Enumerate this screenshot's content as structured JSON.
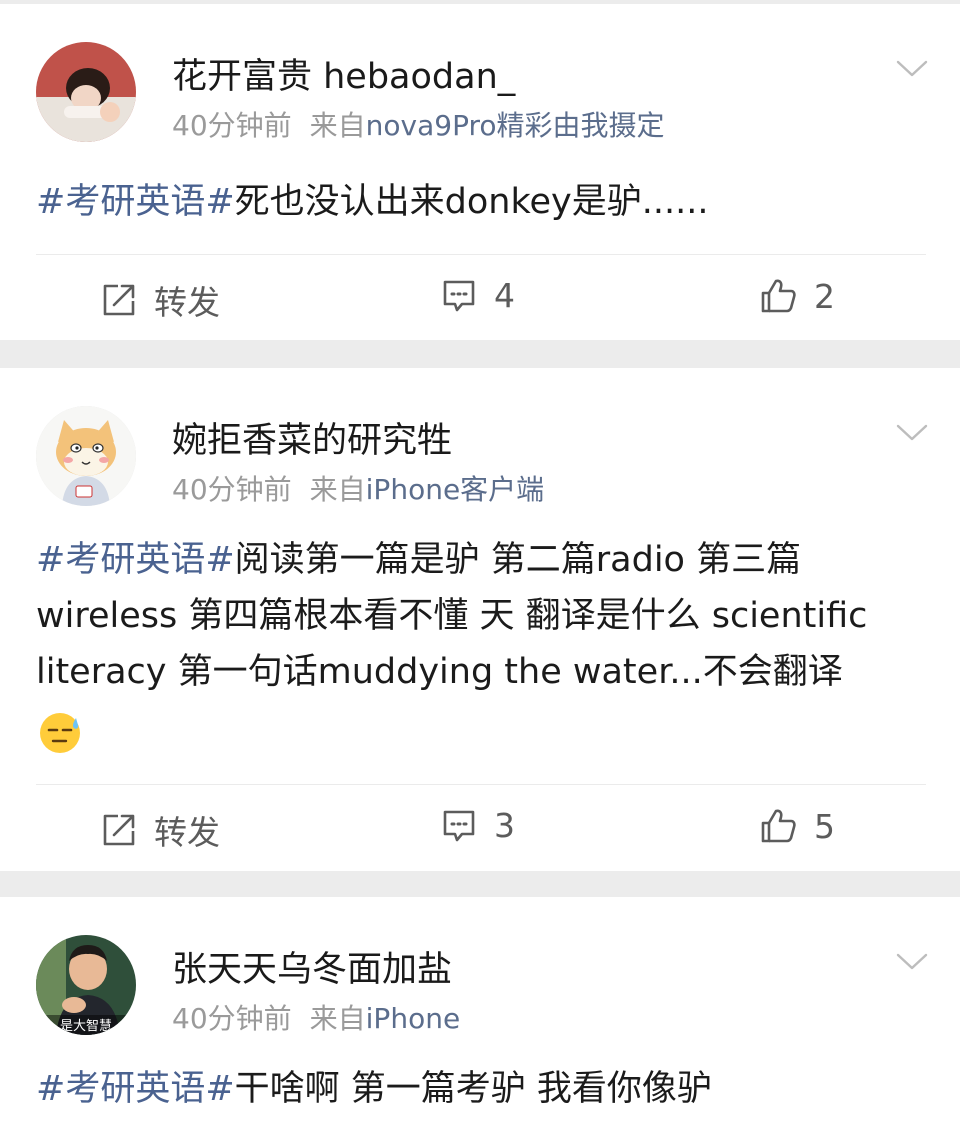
{
  "colors": {
    "hashtag": "#4a6290",
    "source_link": "#5b6d8c",
    "meta_gray": "#9a9a9a",
    "action_gray": "#5c5c5c",
    "background": "#ececec"
  },
  "posts": [
    {
      "username": "花开富贵 hebaodan_",
      "time": "40分钟前",
      "source_prefix": "来自",
      "source": "nova9Pro精彩由我摄定",
      "hashtag": "#考研英语#",
      "text": "死也没认出来donkey是驴......",
      "actions": {
        "repost": "转发",
        "comments": "4",
        "likes": "2"
      },
      "icons": [
        "repost-icon",
        "comment-icon",
        "like-icon",
        "chevron-down-icon"
      ]
    },
    {
      "username": "婉拒香菜的研究牲",
      "time": "40分钟前",
      "source_prefix": "来自",
      "source": "iPhone客户端",
      "hashtag": "#考研英语#",
      "text_line1": "阅读第一篇是驴 第二篇radio 第三篇",
      "text_line2": "wireless 第四篇根本看不懂 天 翻译是什么 scientific",
      "text_line3": "literacy 第一句话muddying the water...不会翻译",
      "emoji": "sweat-face-emoji",
      "actions": {
        "repost": "转发",
        "comments": "3",
        "likes": "5"
      }
    },
    {
      "username": "张天天乌冬面加盐",
      "time": "40分钟前",
      "source_prefix": "来自",
      "source": "iPhone",
      "avatar_caption": "是大智慧",
      "hashtag": "#考研英语#",
      "text": "干啥啊 第一篇考驴 我看你像驴"
    }
  ]
}
